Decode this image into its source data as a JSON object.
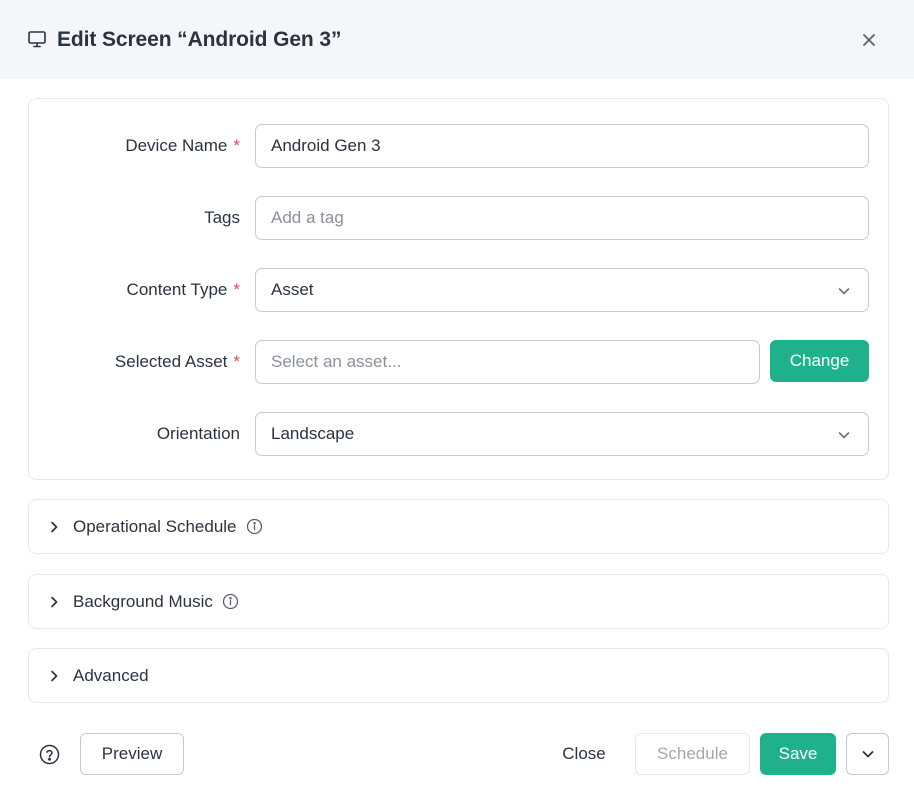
{
  "dialog": {
    "title": "Edit Screen  “Android Gen 3”",
    "close_icon": "close-icon"
  },
  "form": {
    "device_name": {
      "label": "Device Name",
      "required": "*",
      "value": "Android Gen 3"
    },
    "tags": {
      "label": "Tags",
      "placeholder": "Add a tag"
    },
    "content_type": {
      "label": "Content Type",
      "required": "*",
      "value": "Asset"
    },
    "selected_asset": {
      "label": "Selected Asset",
      "required": "*",
      "placeholder": "Select an asset...",
      "change_label": "Change"
    },
    "orientation": {
      "label": "Orientation",
      "value": "Landscape"
    }
  },
  "sections": [
    {
      "title": "Operational Schedule",
      "info": true
    },
    {
      "title": "Background Music",
      "info": true
    },
    {
      "title": "Advanced",
      "info": false
    }
  ],
  "footer": {
    "preview_label": "Preview",
    "close_label": "Close",
    "schedule_label": "Schedule",
    "save_label": "Save"
  },
  "colors": {
    "accent": "#1fb18c",
    "required": "#e5484d",
    "header_bg": "#f4f6f9"
  }
}
